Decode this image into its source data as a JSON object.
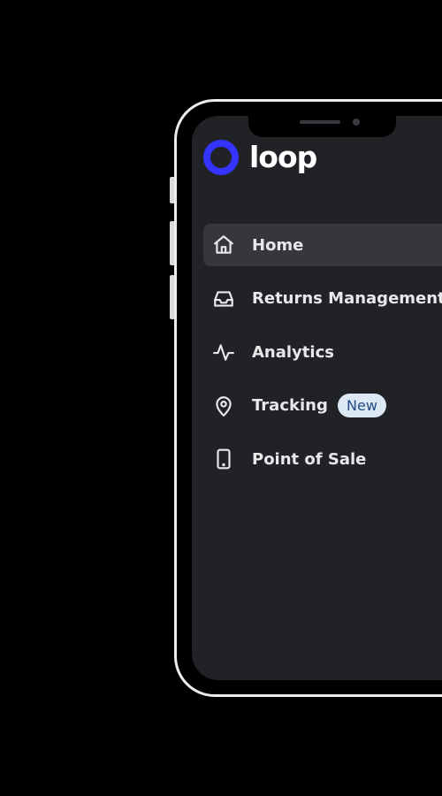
{
  "brand": {
    "name": "loop",
    "accent_color": "#3433ff",
    "logo_icon": "ring-logo-icon"
  },
  "nav": {
    "items": [
      {
        "label": "Home",
        "icon": "home-icon",
        "active": true
      },
      {
        "label": "Returns Management",
        "icon": "inbox-icon",
        "active": false
      },
      {
        "label": "Analytics",
        "icon": "activity-icon",
        "active": false
      },
      {
        "label": "Tracking",
        "icon": "map-pin-icon",
        "active": false,
        "badge": "New"
      },
      {
        "label": "Point of Sale",
        "icon": "tablet-icon",
        "active": false
      }
    ]
  },
  "colors": {
    "screen_background": "#212226",
    "active_item_background": "#36373b",
    "badge_background": "#dce9f5",
    "badge_text": "#1e4b83"
  }
}
